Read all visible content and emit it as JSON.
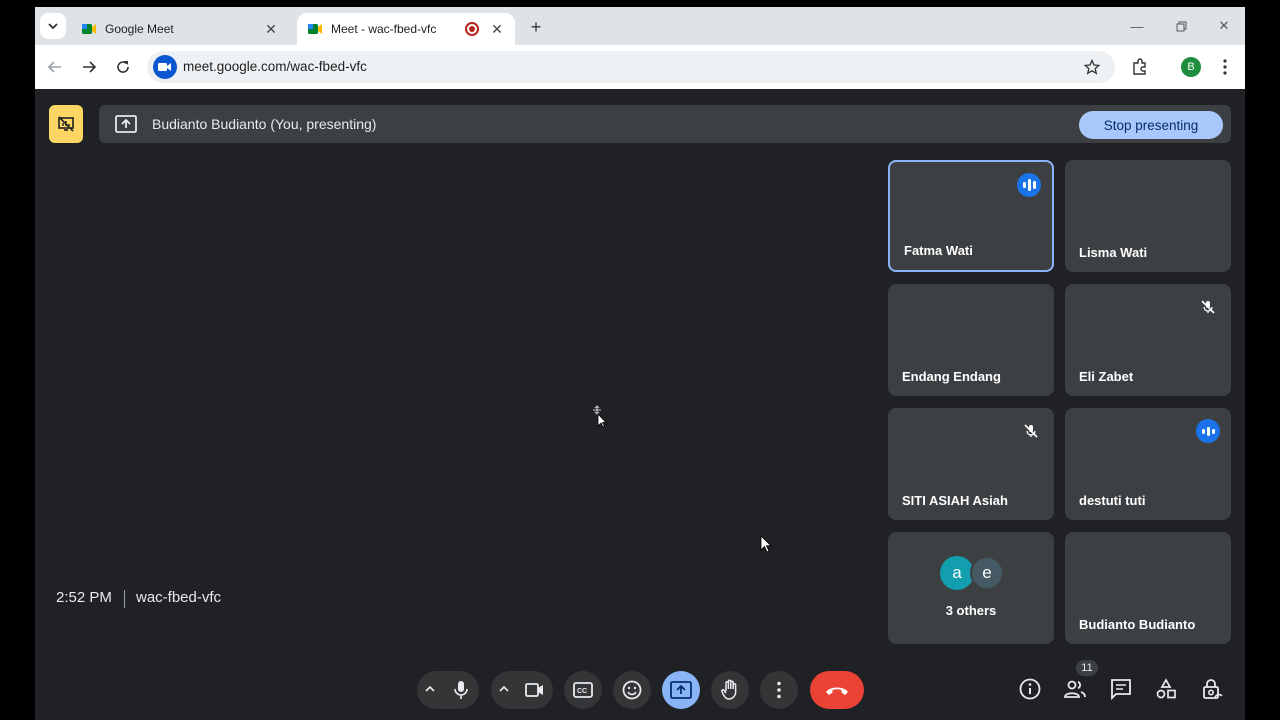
{
  "browser": {
    "tabs": [
      {
        "title": "Google Meet",
        "active": false
      },
      {
        "title": "Meet - wac-fbed-vfc",
        "active": true,
        "recording": true
      }
    ],
    "url": "meet.google.com/wac-fbed-vfc",
    "profile_initial": "B"
  },
  "presenting": {
    "text": "Budianto Budianto (You, presenting)",
    "stop_label": "Stop presenting"
  },
  "participants": [
    {
      "name": "Fatma Wati",
      "state": "speaking"
    },
    {
      "name": "Lisma Wati",
      "state": "none"
    },
    {
      "name": "Endang Endang",
      "state": "none"
    },
    {
      "name": "Eli Zabet",
      "state": "muted"
    },
    {
      "name": "SITI ASIAH Asiah",
      "state": "muted"
    },
    {
      "name": "destuti tuti",
      "state": "speaking"
    },
    {
      "name": "3 others",
      "avatars": [
        "a",
        "e"
      ],
      "state": "group"
    },
    {
      "name": "Budianto Budianto",
      "state": "none"
    }
  ],
  "bottom_bar": {
    "time": "2:52 PM",
    "meeting_code": "wac-fbed-vfc",
    "participant_count": "11"
  },
  "colors": {
    "background": "#202124",
    "tile": "#3c4043",
    "accent": "#8ab4f8",
    "end_call": "#ea4335",
    "present_icon": "#fdd663",
    "avatar_a": "#129eaf",
    "avatar_e": "#455a64"
  },
  "icons": [
    "tab-search-icon",
    "meet-favicon",
    "close-icon",
    "record-icon",
    "plus-icon",
    "minimize-icon",
    "restore-icon",
    "back-icon",
    "forward-icon",
    "reload-icon",
    "site-info-icon",
    "star-icon",
    "extensions-icon",
    "more-vert-icon",
    "present-off-icon",
    "present-icon",
    "speaking-icon",
    "mic-off-icon",
    "chevron-up-icon",
    "mic-icon",
    "camera-icon",
    "captions-icon",
    "emoji-icon",
    "hand-icon",
    "end-call-icon",
    "info-icon",
    "people-icon",
    "chat-icon",
    "activities-icon",
    "host-controls-icon"
  ]
}
